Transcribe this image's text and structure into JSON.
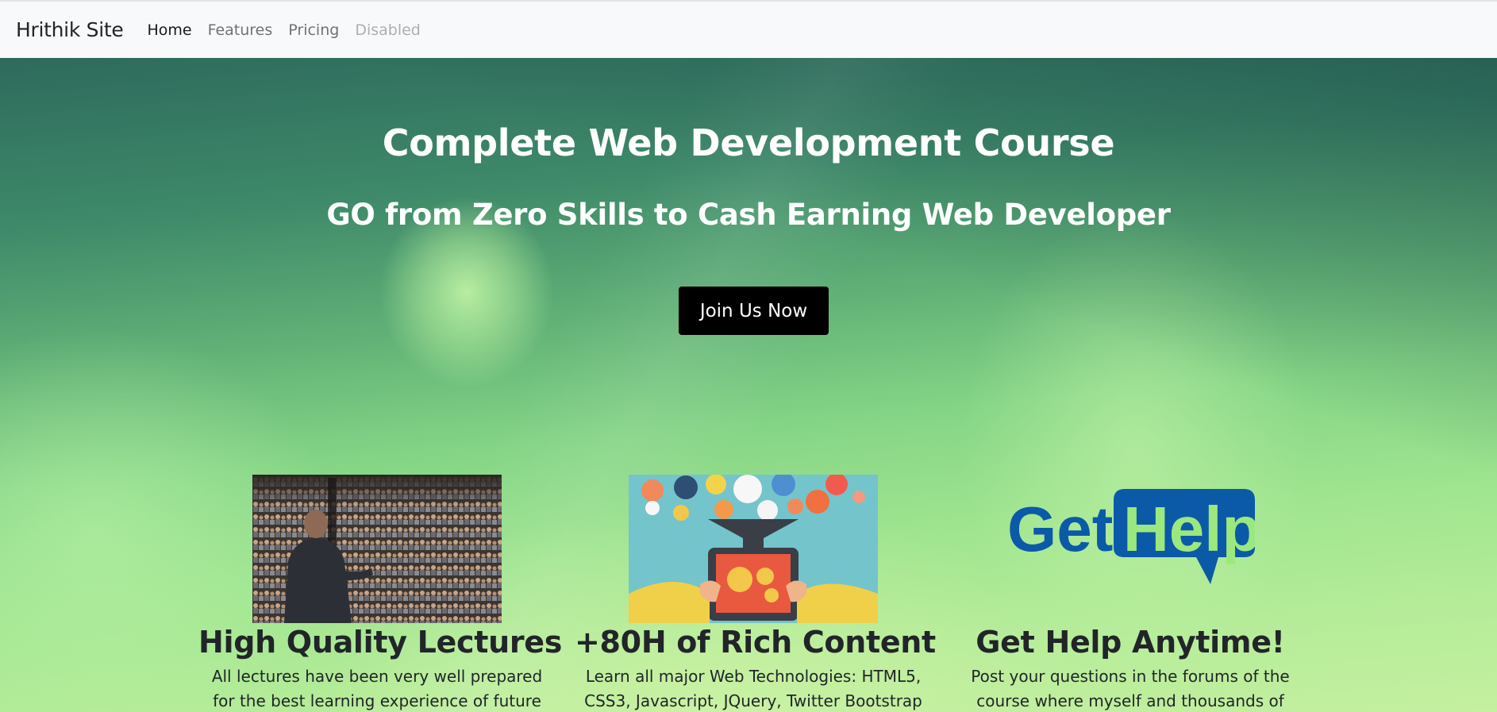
{
  "navbar": {
    "brand": "Hrithik Site",
    "links": [
      {
        "label": "Home",
        "state": "active"
      },
      {
        "label": "Features",
        "state": "normal"
      },
      {
        "label": "Pricing",
        "state": "normal"
      },
      {
        "label": "Disabled",
        "state": "disabled"
      }
    ]
  },
  "hero": {
    "title": "Complete Web Development Course",
    "subtitle": "GO from Zero Skills to Cash Earning Web Developer",
    "cta_label": "Join Us Now"
  },
  "features": [
    {
      "image": "lecture-hall-photo",
      "title": "High Quality Lectures",
      "text": "All lectures have been very well prepared for the best learning experience of future"
    },
    {
      "image": "web-technologies-illustration",
      "title": "+80H of Rich Content",
      "text": "Learn all major Web Technologies: HTML5, CSS3, Javascript, JQuery, Twitter Bootstrap"
    },
    {
      "image": "get-help-logo",
      "logo_text": [
        "Get",
        "Help"
      ],
      "title": "Get Help Anytime!",
      "text": "Post your questions in the forums of the course where myself and thousands of"
    }
  ],
  "colors": {
    "navbar_bg": "#f8f9fa",
    "cta_bg": "#000000",
    "logo_blue": "#0b5aa8",
    "logo_green": "#9be87e"
  }
}
